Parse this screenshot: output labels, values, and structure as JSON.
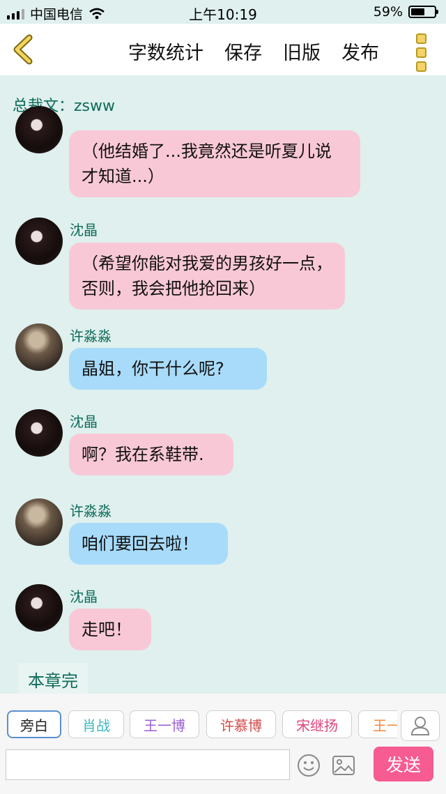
{
  "status_bar": {
    "carrier": "中国电信",
    "time": "上午10:19",
    "battery": "59%",
    "battery_level": 0.59
  },
  "toolbar": {
    "word_count": "字数统计",
    "save": "保存",
    "old_version": "旧版",
    "publish": "发布"
  },
  "author": "总裁文：zsww",
  "messages": [
    {
      "speaker": "",
      "text": "（他结婚了...我竟然还是听夏儿说才知道...）",
      "color": "pink"
    },
    {
      "speaker": "沈晶",
      "text": "（希望你能对我爱的男孩好一点，否则，我会把他抢回来）",
      "color": "pink"
    },
    {
      "speaker": "许淼淼",
      "text": "晶姐，你干什么呢?",
      "color": "blue"
    },
    {
      "speaker": "沈晶",
      "text": "啊？我在系鞋带.",
      "color": "pink"
    },
    {
      "speaker": "许淼淼",
      "text": "咱们要回去啦！",
      "color": "blue"
    },
    {
      "speaker": "沈晶",
      "text": "走吧！",
      "color": "pink"
    }
  ],
  "chapter_end": "本章完",
  "roles": [
    {
      "label": "旁白",
      "color": "#222222"
    },
    {
      "label": "肖战",
      "color": "#3fb7c1"
    },
    {
      "label": "王一博",
      "color": "#9a5fd3"
    },
    {
      "label": "许慕博",
      "color": "#d24b4b"
    },
    {
      "label": "宋继扬",
      "color": "#e0477f"
    },
    {
      "label": "王一",
      "color": "#f08a3e"
    }
  ],
  "input": {
    "value": ""
  },
  "send": "发送"
}
